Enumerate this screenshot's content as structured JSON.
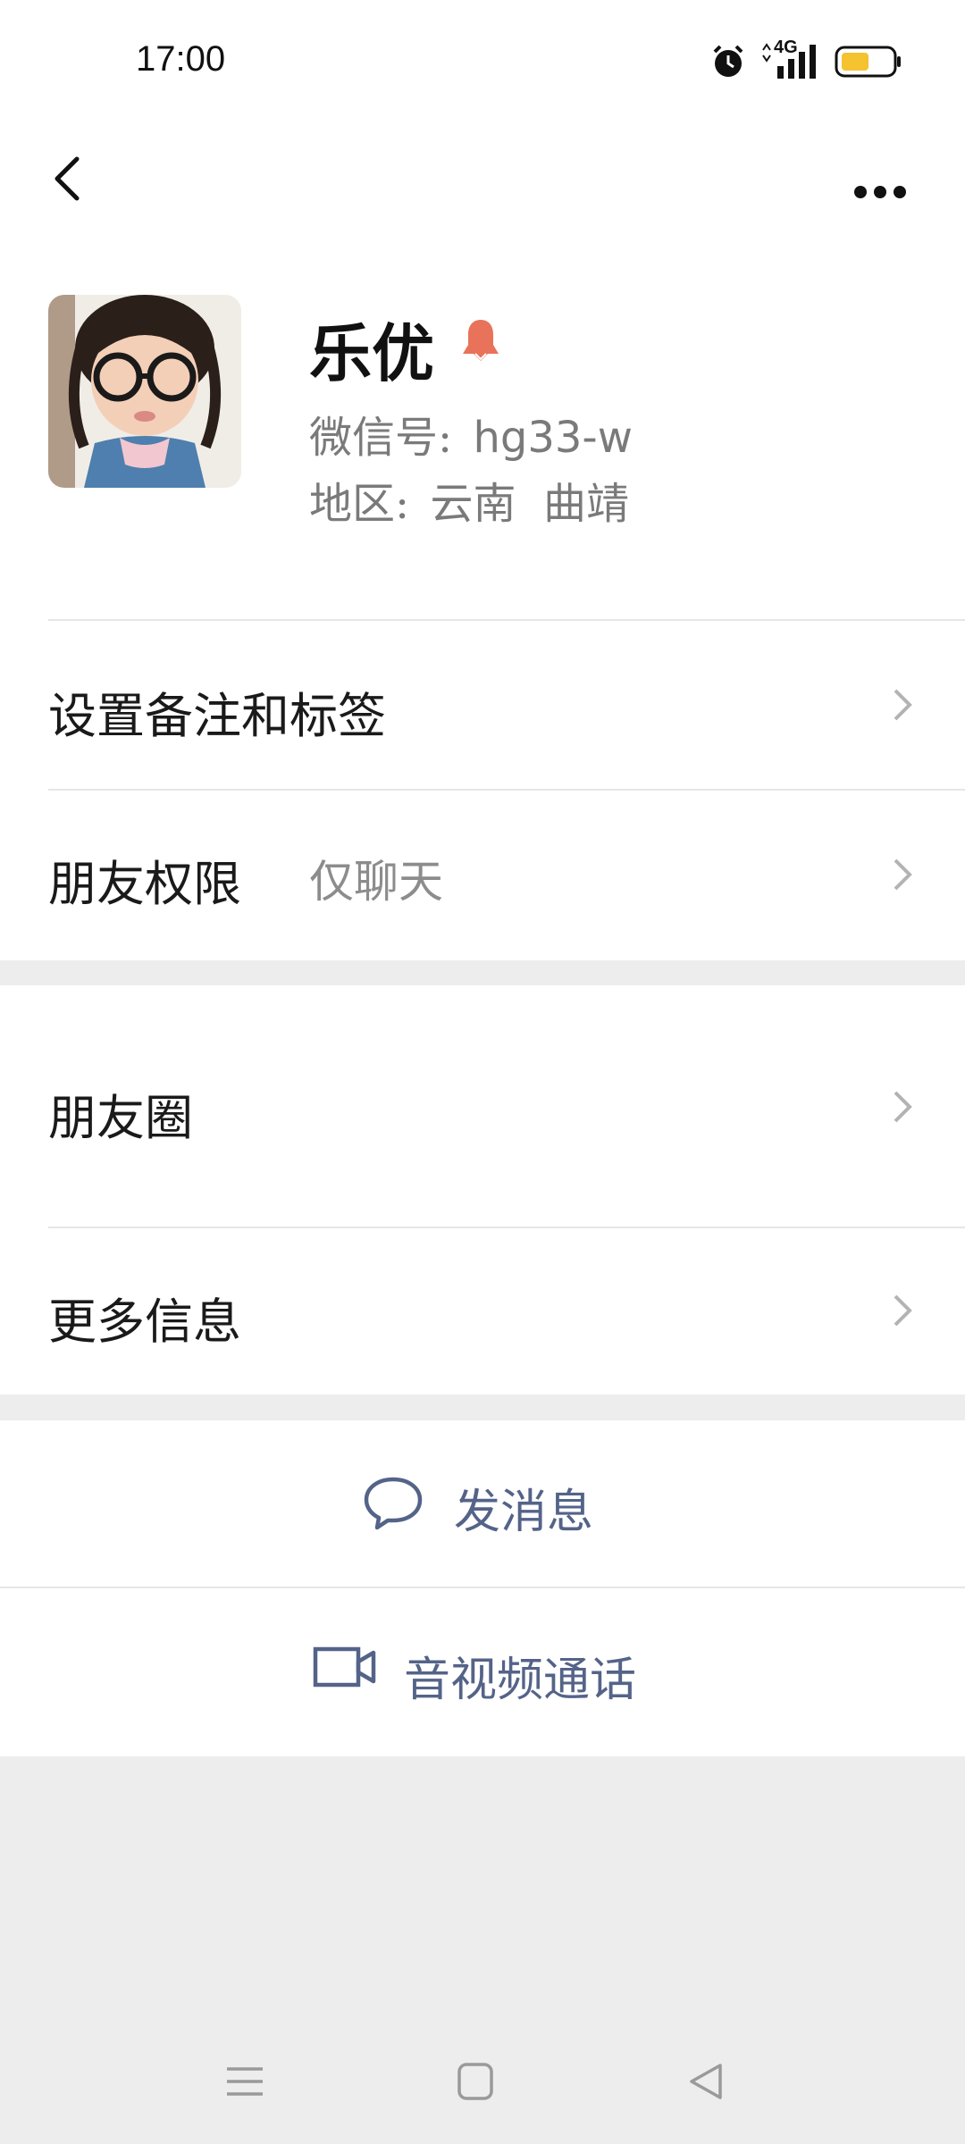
{
  "status_bar": {
    "time": "17:00",
    "network": "4G",
    "icons": [
      "alarm-icon",
      "signal-icon",
      "battery-icon"
    ]
  },
  "header": {
    "back_icon": "back-chevron-icon",
    "more_icon": "more-dots-icon"
  },
  "profile": {
    "name": "乐优",
    "gender_icon": "female-icon",
    "wechat_id_label": "微信号:",
    "wechat_id": "hg33-w",
    "region_label": "地区:",
    "region": "云南  曲靖"
  },
  "settings": {
    "remarks_label": "设置备注和标签",
    "permissions_label": "朋友权限",
    "permissions_value": "仅聊天"
  },
  "moments": {
    "label": "朋友圈"
  },
  "more_info": {
    "label": "更多信息"
  },
  "actions": {
    "send_message": "发消息",
    "video_call": "音视频通话"
  },
  "colors": {
    "accent": "#546388",
    "gender": "#e8735a",
    "battery": "#f5c230"
  }
}
